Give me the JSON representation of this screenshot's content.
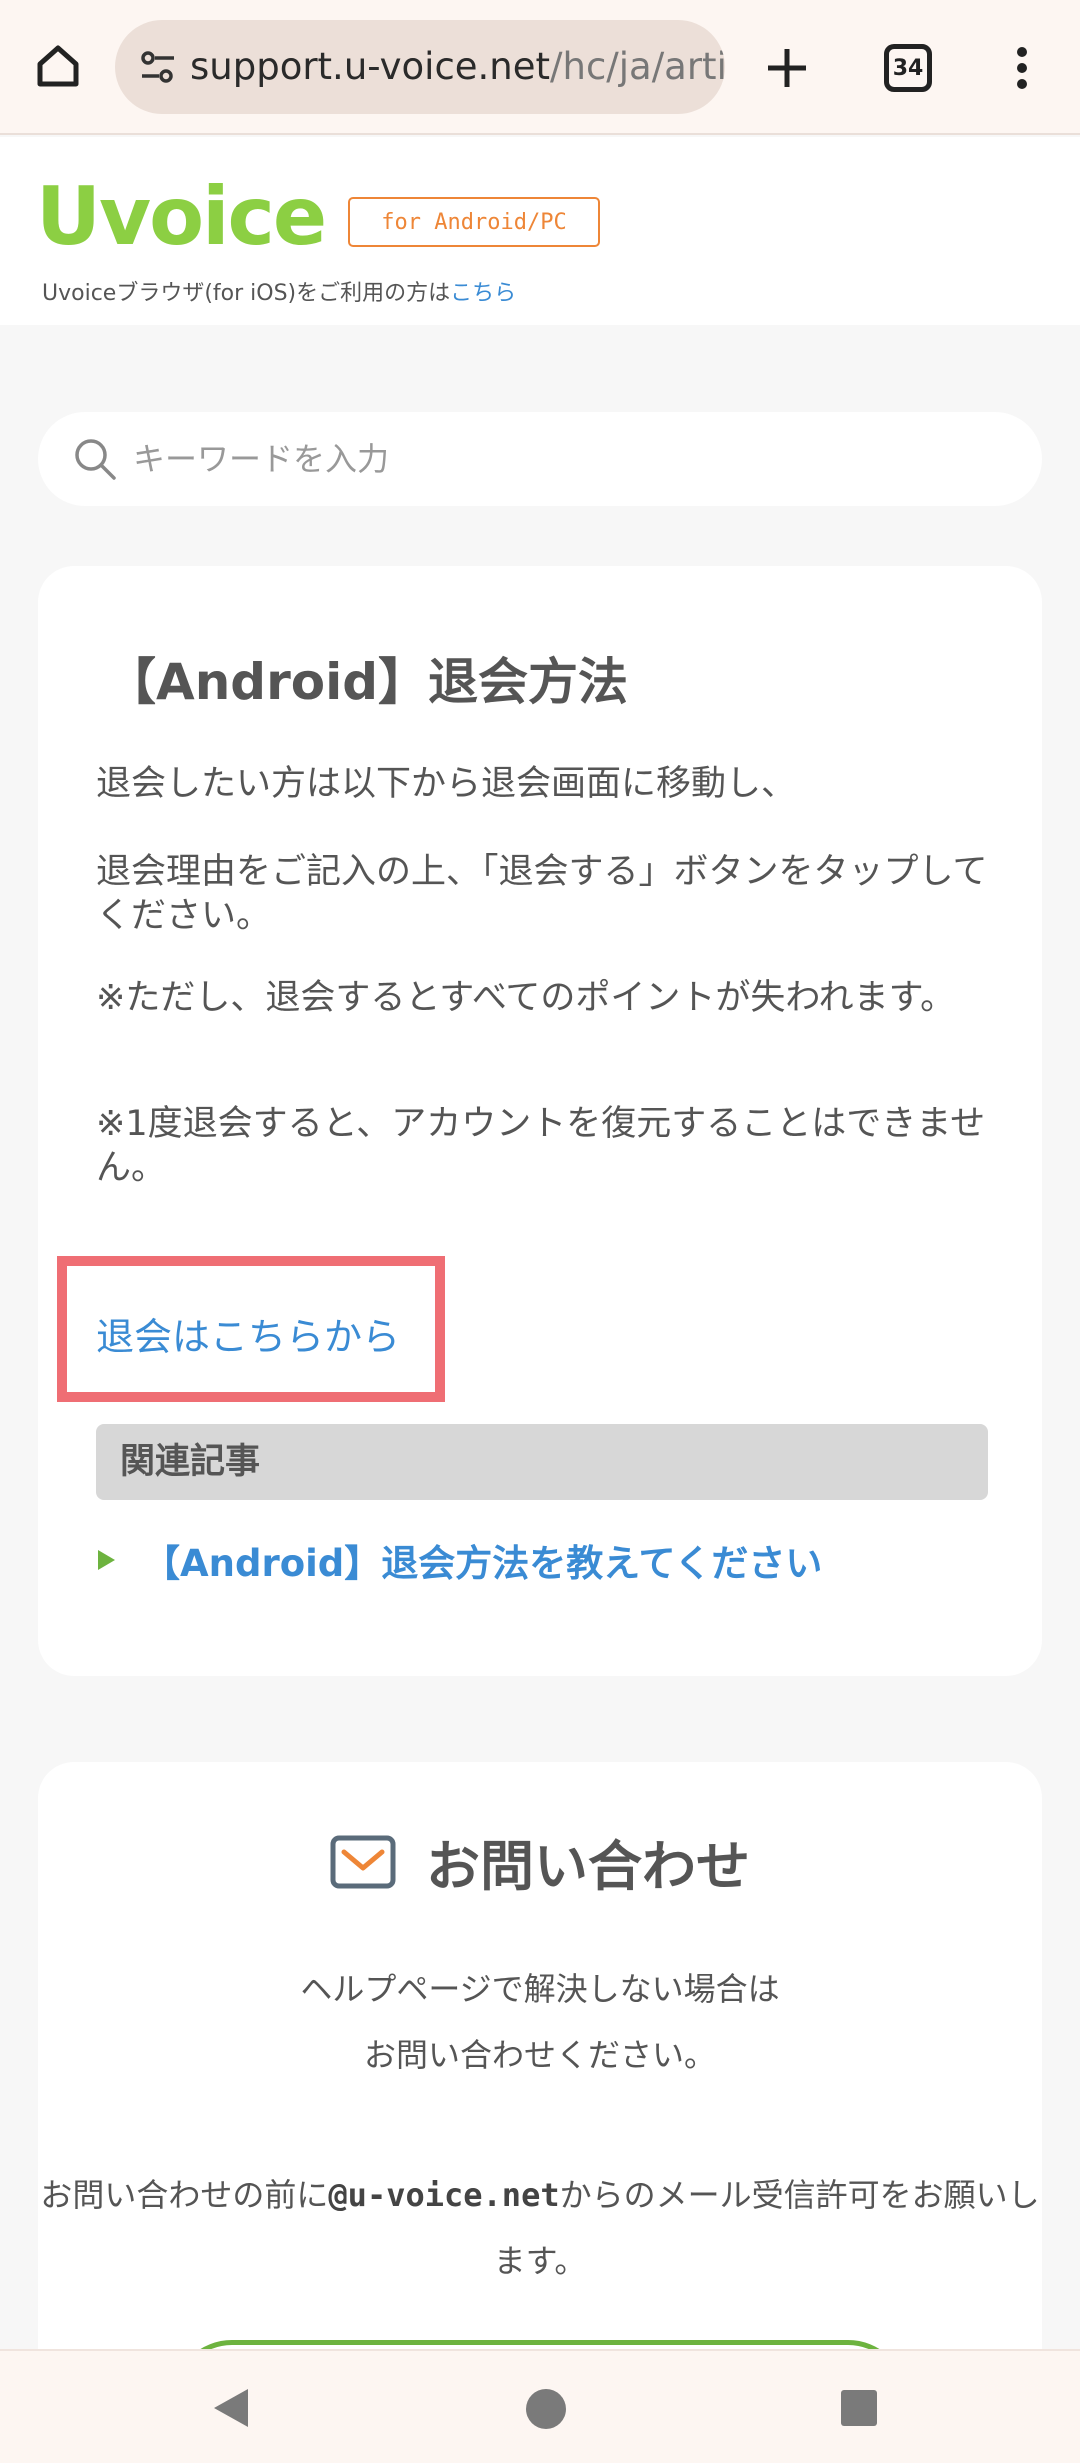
{
  "browser": {
    "url_host": "support.u-voice.net",
    "url_path": "/hc/ja/artic",
    "tab_count": "34"
  },
  "header": {
    "logo_text": "Uvoice",
    "platform_badge": "for Android/PC",
    "ios_note_prefix": "Uvoiceブラウザ(for iOS)をご利用の方は",
    "ios_note_link": "こちら"
  },
  "search": {
    "placeholder": "キーワードを入力"
  },
  "article": {
    "title": "【Android】退会方法",
    "paragraphs": [
      "退会したい方は以下から退会画面に移動し、",
      "退会理由をご記入の上、「退会する」ボタンをタップしてください。",
      "※ただし、退会するとすべてのポイントが失われます。",
      "※1度退会すると、アカウントを復元することはできません。"
    ],
    "withdraw_link": "退会はこちらから",
    "related_heading": "関連記事",
    "related_items": [
      "【Android】退会方法を教えてください"
    ]
  },
  "contact": {
    "title": "お問い合わせ",
    "line1": "ヘルプページで解決しない場合は",
    "line2": "お問い合わせください。",
    "note_prefix": "お問い合わせの前に",
    "note_domain": "@u-voice.net",
    "note_suffix": "からのメール受信許可をお願いします。"
  },
  "colors": {
    "accent_green": "#8ccf43",
    "link_blue": "#3a8bd4",
    "badge_orange": "#ee8637",
    "highlight_red": "#ef6e74"
  }
}
